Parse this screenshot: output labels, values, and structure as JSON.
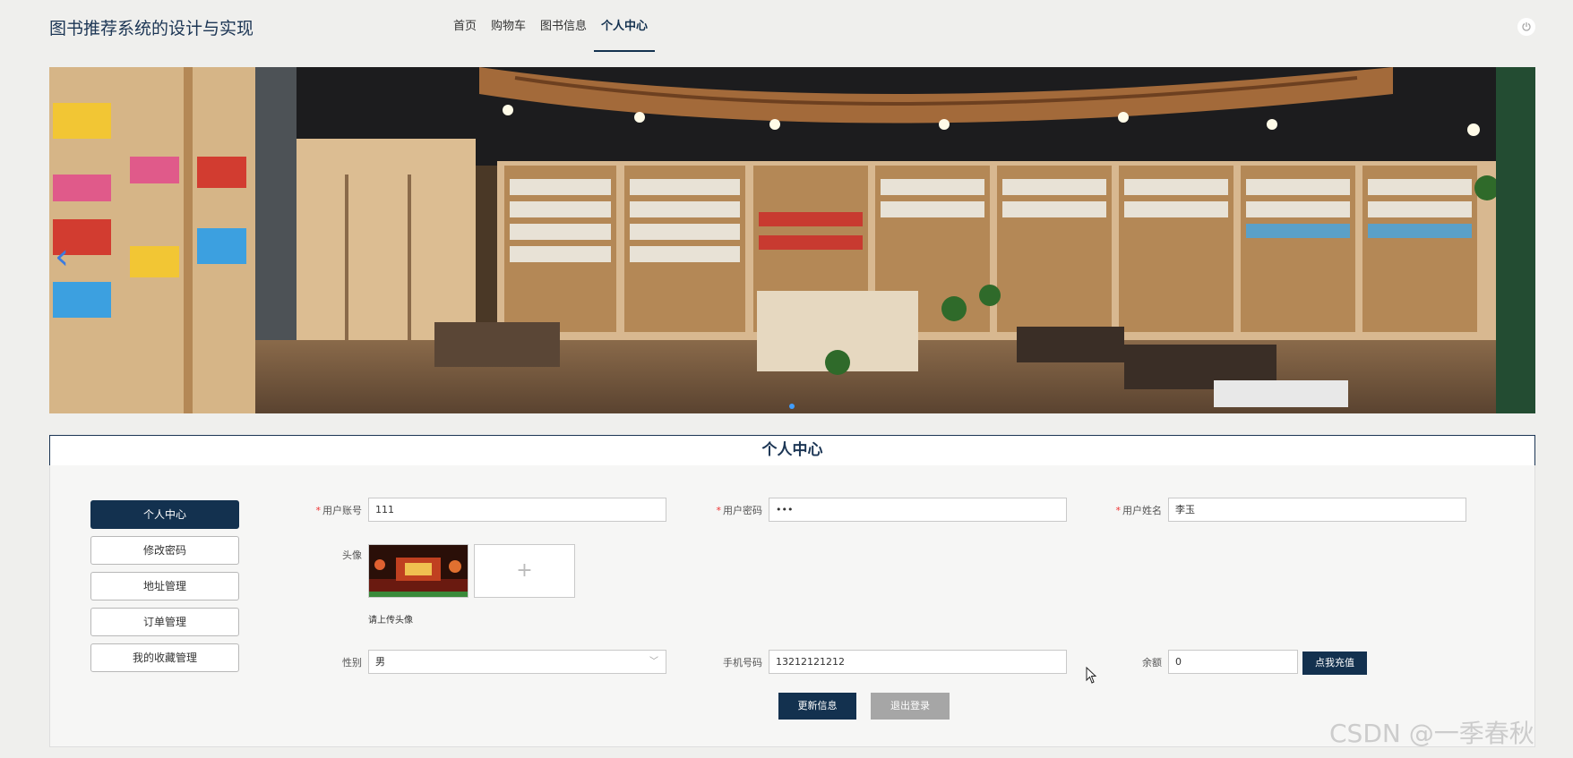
{
  "header": {
    "site_title": "图书推荐系统的设计与实现",
    "nav": [
      {
        "label": "首页"
      },
      {
        "label": "购物车"
      },
      {
        "label": "图书信息"
      },
      {
        "label": "个人中心"
      }
    ],
    "active_nav": "个人中心",
    "power_icon": "power-icon"
  },
  "banner": {
    "prev_arrow": "‹",
    "active_slide": 1
  },
  "section": {
    "title": "个人中心"
  },
  "side_menu": {
    "items": [
      {
        "label": "个人中心"
      },
      {
        "label": "修改密码"
      },
      {
        "label": "地址管理"
      },
      {
        "label": "订单管理"
      },
      {
        "label": "我的收藏管理"
      }
    ],
    "active": "个人中心"
  },
  "form": {
    "account": {
      "label": "用户账号",
      "value": "111"
    },
    "password": {
      "label": "用户密码",
      "value": "•••"
    },
    "name": {
      "label": "用户姓名",
      "value": "李玉"
    },
    "avatar": {
      "label": "头像",
      "upload_plus": "+",
      "hint": "请上传头像"
    },
    "gender": {
      "label": "性别",
      "value": "男"
    },
    "phone": {
      "label": "手机号码",
      "value": "13212121212"
    },
    "balance": {
      "label": "余额",
      "value": "0"
    },
    "charge_button": "点我充值",
    "update_button": "更新信息",
    "logout_button": "退出登录"
  },
  "watermark": "CSDN @一季春秋",
  "colors": {
    "primary": "#13314f",
    "title": "#1b3554",
    "gray_button": "#a6a6a6",
    "required": "#e33333"
  }
}
